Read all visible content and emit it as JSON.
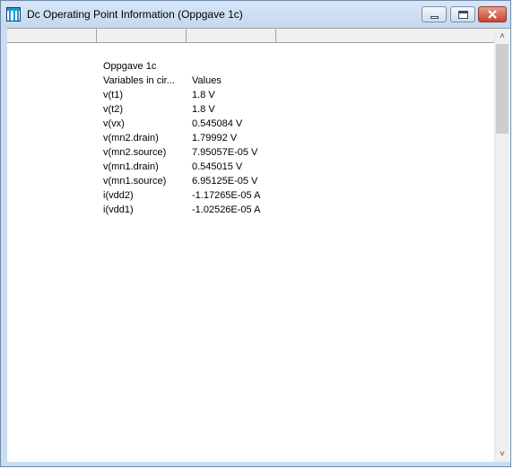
{
  "window": {
    "title": "Dc Operating Point Information (Oppgave 1c)",
    "icon": "app-window-icon",
    "controls": {
      "minimize": "minimize-icon",
      "maximize": "maximize-icon",
      "close": "close-icon"
    }
  },
  "header_columns": [
    "",
    "",
    ""
  ],
  "report": {
    "title": "Oppgave 1c",
    "column_names_label": "Variables in cir...",
    "column_values_label": "Values",
    "rows": [
      {
        "name": "v(t1)",
        "value": "1.8 V"
      },
      {
        "name": "v(t2)",
        "value": "1.8 V"
      },
      {
        "name": "v(vx)",
        "value": "0.545084 V"
      },
      {
        "name": "v(mn2.drain)",
        "value": "1.79992 V"
      },
      {
        "name": "v(mn2.source)",
        "value": "7.95057E-05 V"
      },
      {
        "name": "v(mn1.drain)",
        "value": "0.545015 V"
      },
      {
        "name": "v(mn1.source)",
        "value": "6.95125E-05 V"
      },
      {
        "name": "i(vdd2)",
        "value": "-1.17265E-05 A"
      },
      {
        "name": "i(vdd1)",
        "value": "-1.02526E-05 A"
      }
    ]
  },
  "scrollbar": {
    "up_glyph": "˄",
    "down_glyph": "˅"
  }
}
